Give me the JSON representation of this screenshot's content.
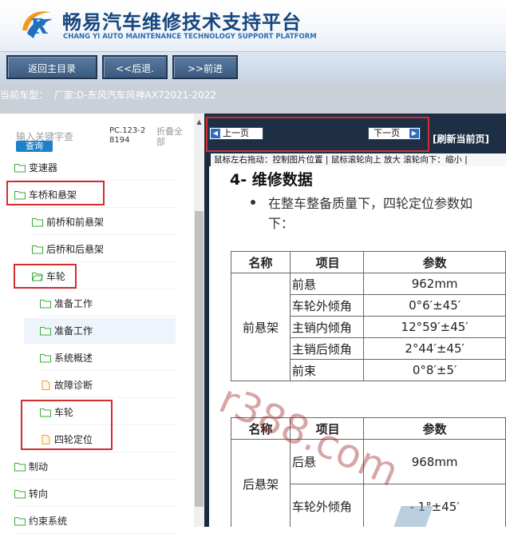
{
  "header": {
    "title": "畅易汽车维修技术支持平台",
    "subtitle": "CHANG YI AUTO MAINTENANCE TECHNOLOGY SUPPORT PLATFORM",
    "colors": {
      "title": "#16467e",
      "subtitle": "#2a6db2",
      "logo_orange": "#f39a1e",
      "logo_blue": "#1f6fc0"
    }
  },
  "nav": {
    "home_label": "返回主目录",
    "back_label": "<<后退.",
    "forward_label": ">>前进"
  },
  "vehicle": {
    "label": "当前车型：",
    "value": "厂家:D-东风汽车风神AX72021-2022"
  },
  "sidebar": {
    "search_placeholder": "输入关键字查",
    "search_button": "查询",
    "pc_code": "PC.123-28194",
    "collapse_all": "折叠全部",
    "items": [
      {
        "label": "变速器",
        "icon": "folder-icon"
      },
      {
        "label": "车桥和悬架",
        "icon": "folder-icon",
        "highlighted": true
      },
      {
        "label": "前桥和前悬架",
        "icon": "folder-icon"
      },
      {
        "label": "后桥和后悬架",
        "icon": "folder-icon"
      },
      {
        "label": "车轮",
        "icon": "folder-open-icon",
        "highlighted": true
      },
      {
        "label": "准备工作",
        "icon": "folder-icon"
      },
      {
        "label": "准备工作",
        "icon": "folder-icon",
        "selected": true
      },
      {
        "label": "系统概述",
        "icon": "folder-icon"
      },
      {
        "label": "故障诊断",
        "icon": "document-icon"
      },
      {
        "label": "车轮",
        "icon": "folder-icon",
        "highlighted": true
      },
      {
        "label": "四轮定位",
        "icon": "document-icon",
        "highlighted": true
      },
      {
        "label": "制动",
        "icon": "folder-icon"
      },
      {
        "label": "转向",
        "icon": "folder-icon"
      },
      {
        "label": "约束系统",
        "icon": "folder-icon"
      }
    ]
  },
  "viewer": {
    "prev_page": "上一页",
    "next_page": "下一页",
    "refresh": "[刷新当前页]",
    "hint": "鼠标左右拖动：控制图片位置 | 鼠标滚轮向上 放大  滚轮向下：缩小 |",
    "section_title": "4- 维修数据",
    "bullet_line1": "在整车整备质量下，四轮定位参数如",
    "bullet_line2": "下：",
    "table1": {
      "headers": [
        "名称",
        "项目",
        "参数"
      ],
      "group": "前悬架",
      "rows": [
        {
          "item": "前悬",
          "param": "962mm"
        },
        {
          "item": "车轮外倾角",
          "param": "0°6′±45′"
        },
        {
          "item": "主销内倾角",
          "param": "12°59′±45′"
        },
        {
          "item": "主销后倾角",
          "param": "2°44′±45′"
        },
        {
          "item": "前束",
          "param": "0°8′±5′"
        }
      ]
    },
    "table2": {
      "headers": [
        "名称",
        "项目",
        "参数"
      ],
      "group": "后悬架",
      "rows": [
        {
          "item": "后悬",
          "param": "968mm"
        },
        {
          "item": "车轮外倾角",
          "param": "- 1°±45′"
        }
      ]
    },
    "watermark": "r388.com",
    "colors": {
      "highlight_box": "#d42d2d",
      "viewer_bg": "#1b2a3d",
      "search_button": "#1e80c8"
    }
  }
}
